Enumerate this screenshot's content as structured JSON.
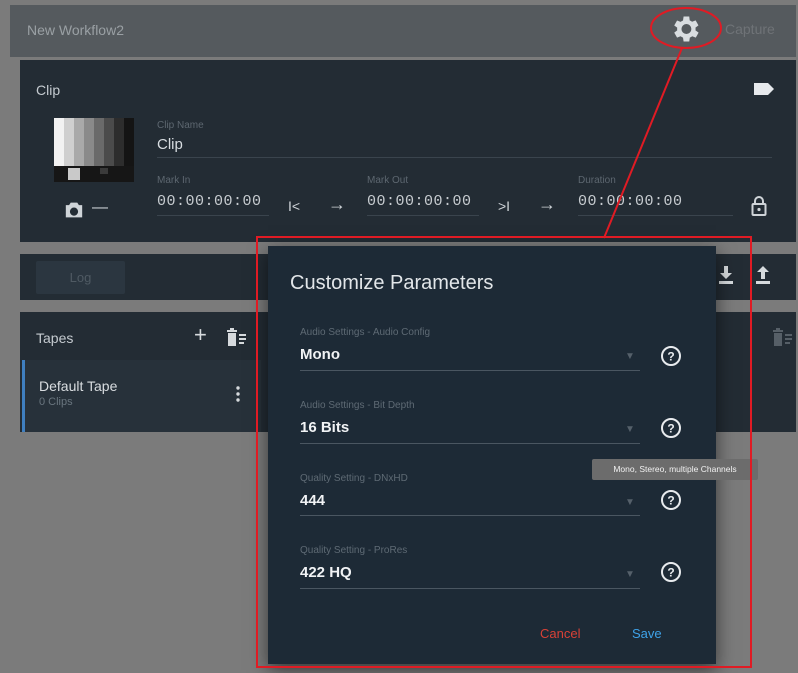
{
  "window": {
    "title": "New Workflow2",
    "capture_label": "Capture"
  },
  "clip": {
    "section_title": "Clip",
    "name_label": "Clip Name",
    "name_value": "Clip",
    "mark_in_label": "Mark In",
    "mark_in_value": "00:00:00:00",
    "mark_out_label": "Mark Out",
    "mark_out_value": "00:00:00:00",
    "duration_label": "Duration",
    "duration_value": "00:00:00:00",
    "go_start_glyph": "I<",
    "go_end_glyph": ">I",
    "arrow_glyph": "→",
    "minus_glyph": "—"
  },
  "log": {
    "button_label": "Log"
  },
  "tapes": {
    "section_title": "Tapes",
    "add_glyph": "+",
    "items": [
      {
        "name": "Default Tape",
        "count": "0 Clips"
      }
    ]
  },
  "dialog": {
    "title": "Customize Parameters",
    "fields": [
      {
        "label": "Audio Settings - Audio Config",
        "value": "Mono"
      },
      {
        "label": "Audio Settings - Bit Depth",
        "value": "16 Bits"
      },
      {
        "label": "Quality Setting - DNxHD",
        "value": "444"
      },
      {
        "label": "Quality Setting - ProRes",
        "value": "422 HQ"
      }
    ],
    "tooltip": "Mono, Stereo, multiple Channels",
    "cancel_label": "Cancel",
    "save_label": "Save",
    "caret_glyph": "▼"
  },
  "icons": [
    "gear-icon",
    "tag-icon",
    "camera-icon",
    "lock-icon",
    "download-icon",
    "upload-icon",
    "delete-icon",
    "more-vert-icon",
    "help-icon"
  ],
  "colors": {
    "annotation_red": "#e01b24",
    "cancel": "#d84136",
    "save": "#3ea2e8",
    "accent_blue": "#3f7fc0"
  }
}
